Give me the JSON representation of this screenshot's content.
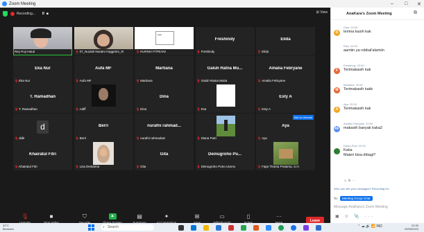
{
  "window": {
    "title": "Zoom Meeting",
    "controls": [
      "–",
      "□",
      "✕"
    ]
  },
  "topbar": {
    "recording": "Recording...",
    "pause": "II",
    "stop": "■",
    "view": "View"
  },
  "tiles": [
    {
      "id": "t1",
      "name": "",
      "label": "Rey Puji Astuti",
      "muted": false,
      "active": true,
      "kind": "video1"
    },
    {
      "id": "t2",
      "name": "",
      "label": "07_Nuziah Nuraini Anggreini_XI",
      "muted": true,
      "kind": "video2"
    },
    {
      "id": "t3",
      "name": "",
      "label": "KURNIA FITRIANI",
      "muted": true,
      "kind": "video3"
    },
    {
      "id": "t4",
      "name": "Freshindy",
      "label": "Freshindy",
      "muted": true
    },
    {
      "id": "t5",
      "name": "Elida",
      "label": "Elida",
      "muted": true
    },
    {
      "id": "t6",
      "name": "Eka Nur",
      "label": "Eka Nur",
      "muted": true
    },
    {
      "id": "t7",
      "name": "Aufa MF",
      "label": "Aufa MF",
      "muted": true
    },
    {
      "id": "t8",
      "name": "Martiana",
      "label": "Martiana",
      "muted": true
    },
    {
      "id": "t9",
      "name": "Galuh Ratna Mu...",
      "label": "Galuh Ratna Mutia",
      "muted": true
    },
    {
      "id": "t10",
      "name": "Amalia Febryane",
      "label": "Amalia Febryane",
      "muted": true
    },
    {
      "id": "t11",
      "name": "T. Ramadhan",
      "label": "T. Ramadhan",
      "muted": true
    },
    {
      "id": "t12",
      "name": "",
      "label": "Adiff",
      "muted": true,
      "kind": "photo-dark"
    },
    {
      "id": "t13",
      "name": "Dina",
      "label": "Dina",
      "muted": true
    },
    {
      "id": "t14",
      "name": "",
      "label": "Esa",
      "muted": true,
      "kind": "white"
    },
    {
      "id": "t15",
      "name": "Esty A",
      "label": "Esty A",
      "muted": true
    },
    {
      "id": "t16",
      "name": "",
      "label": "didit",
      "muted": true,
      "kind": "avatar-d",
      "avatar": "d"
    },
    {
      "id": "t17",
      "name": "Berri",
      "label": "Berri",
      "muted": true
    },
    {
      "id": "t18",
      "name": "nurafni rahmad...",
      "label": "nurafni rahmadani",
      "muted": true
    },
    {
      "id": "t19",
      "name": "",
      "label": "Diana Putri",
      "muted": true,
      "kind": "photo-outdoor"
    },
    {
      "id": "t20",
      "name": "Aya",
      "label": "Aya",
      "muted": true,
      "unmute": "Ask to Unmute"
    },
    {
      "id": "t21",
      "name": "Khairatul Fitri",
      "label": "Khairatul Fitri",
      "muted": true
    },
    {
      "id": "t22",
      "name": "",
      "label": "Lisa Destarina",
      "muted": true,
      "kind": "photo-hijab"
    },
    {
      "id": "t23",
      "name": "Gita",
      "label": "Gita",
      "muted": true
    },
    {
      "id": "t24",
      "name": "Deinugroho Pu...",
      "label": "Deinugroho Putro Utomo",
      "muted": true
    },
    {
      "id": "t25",
      "name": "",
      "label": "Fajar Tirama Pratama, S.H.",
      "muted": true,
      "kind": "photo-green"
    }
  ],
  "toolbar": [
    {
      "id": "unmute",
      "label": "Unmute",
      "icon": "mic-off-icon",
      "glyph": "🎙"
    },
    {
      "id": "video",
      "label": "Stop Video",
      "icon": "video-icon",
      "glyph": "■"
    },
    {
      "id": "security",
      "label": "Security",
      "icon": "shield-icon",
      "glyph": "⛉"
    },
    {
      "id": "share",
      "label": "Share Screen",
      "icon": "share-icon",
      "glyph": "▲"
    },
    {
      "id": "summary",
      "label": "Summary",
      "icon": "summary-icon",
      "glyph": "▤"
    },
    {
      "id": "companion",
      "label": "AI Companion",
      "icon": "sparkle-icon",
      "glyph": "✦"
    },
    {
      "id": "apps",
      "label": "Apps",
      "icon": "apps-icon",
      "glyph": "⊞"
    },
    {
      "id": "whiteboards",
      "label": "Whiteboards",
      "icon": "whiteboard-icon",
      "glyph": "▭"
    },
    {
      "id": "notes",
      "label": "Notes",
      "icon": "notes-icon",
      "glyph": "▯"
    },
    {
      "id": "more",
      "label": "More",
      "icon": "more-icon",
      "glyph": "···"
    }
  ],
  "leave_label": "Leave",
  "chat": {
    "title": "AnaKara's Zoom Meeting",
    "messages": [
      {
        "sender": "Dina",
        "time": "22:00",
        "text": "terima kasih kak",
        "color": "#f5a623",
        "initial": "D"
      },
      {
        "sender": "Elsa",
        "time": "22:00",
        "text": "aamiin ya robbal'alamiin",
        "color": "",
        "initial": ""
      },
      {
        "sender": "Freshindy",
        "time": "22:00",
        "text": "Terimakasih kak",
        "color": "#e8693a",
        "initial": "F"
      },
      {
        "sender": "Martiana",
        "time": "22:00",
        "text": "Terimakasih kakk",
        "color": "#e8693a",
        "initial": "M"
      },
      {
        "sender": "Aya",
        "time": "22:00",
        "text": "Terimakasih kak",
        "color": "#f5a623",
        "initial": "A"
      },
      {
        "sender": "Amalia Febryane",
        "time": "22:00",
        "text": "makasih banyak kaka2",
        "color": "#5b8def",
        "initial": "AF"
      },
      {
        "sender": "Diana Putri",
        "time": "22:00",
        "text": "Kaka",
        "text2": "Materi bisa dibagi?",
        "color": "#2e7d32",
        "initial": ""
      }
    ],
    "notice": "Who can see your messages? Recording On",
    "to_label": "To:",
    "to_value": "Meeting Group Chat",
    "input_placeholder": "Message AnaKara's Zoom Meeting"
  },
  "taskbar": {
    "weather_temp": "32°C",
    "weather_desc": "Berawan",
    "search_placeholder": "Search",
    "time": "22:00",
    "date": "29/05/2024"
  }
}
